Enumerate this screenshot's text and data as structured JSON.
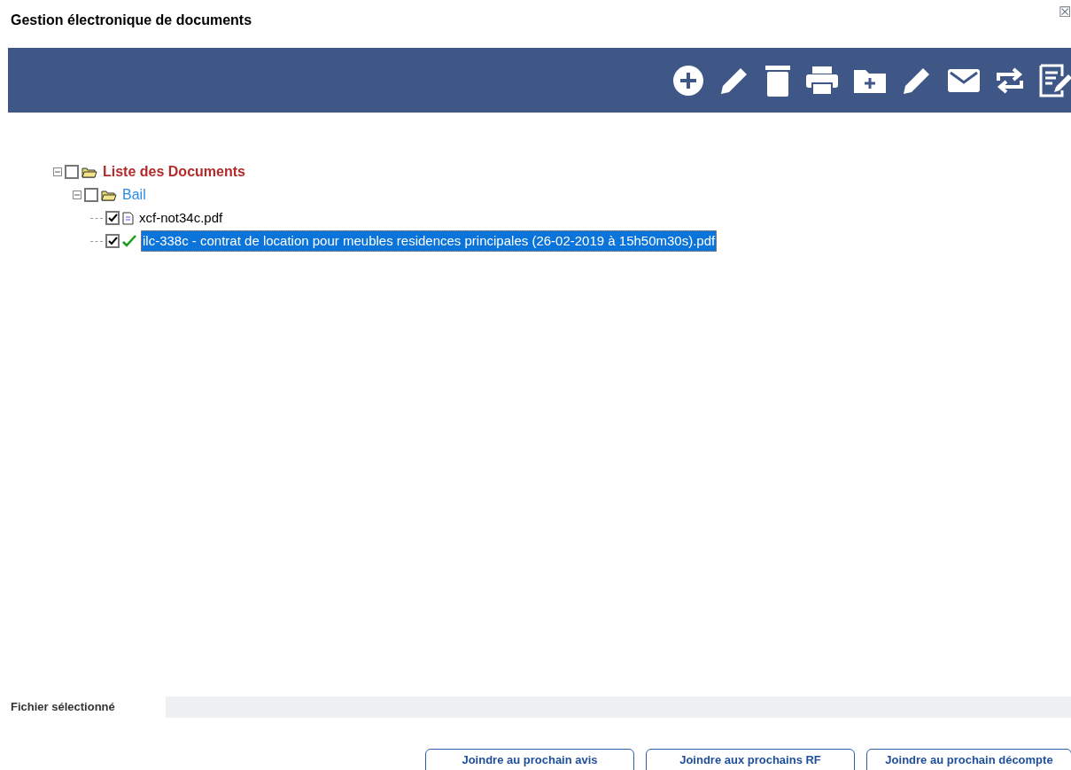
{
  "window": {
    "title": "Gestion électronique de documents",
    "close_glyph": "☒"
  },
  "tree": [
    {
      "label": "Liste des Documents",
      "kind": "folder",
      "color": "#b22a2a",
      "expanded": true,
      "checked": false,
      "selected": false,
      "children": [
        {
          "label": "Bail",
          "kind": "folder",
          "color": "#2d8be6",
          "expanded": true,
          "checked": false,
          "selected": false,
          "children": [
            {
              "label": "xcf-not34c.pdf",
              "kind": "file",
              "checked": true,
              "selected": false
            },
            {
              "label": "ilc-338c - contrat de location pour meubles residences principales (26-02-2019 à 15h50m30s).pdf",
              "kind": "signed",
              "checked": true,
              "selected": true
            }
          ]
        }
      ]
    }
  ],
  "selected_file": {
    "label": "Fichier sélectionné"
  },
  "buttons": [
    "Joindre au prochain avis",
    "Joindre aux prochains RF",
    "Joindre au prochain décompte"
  ]
}
